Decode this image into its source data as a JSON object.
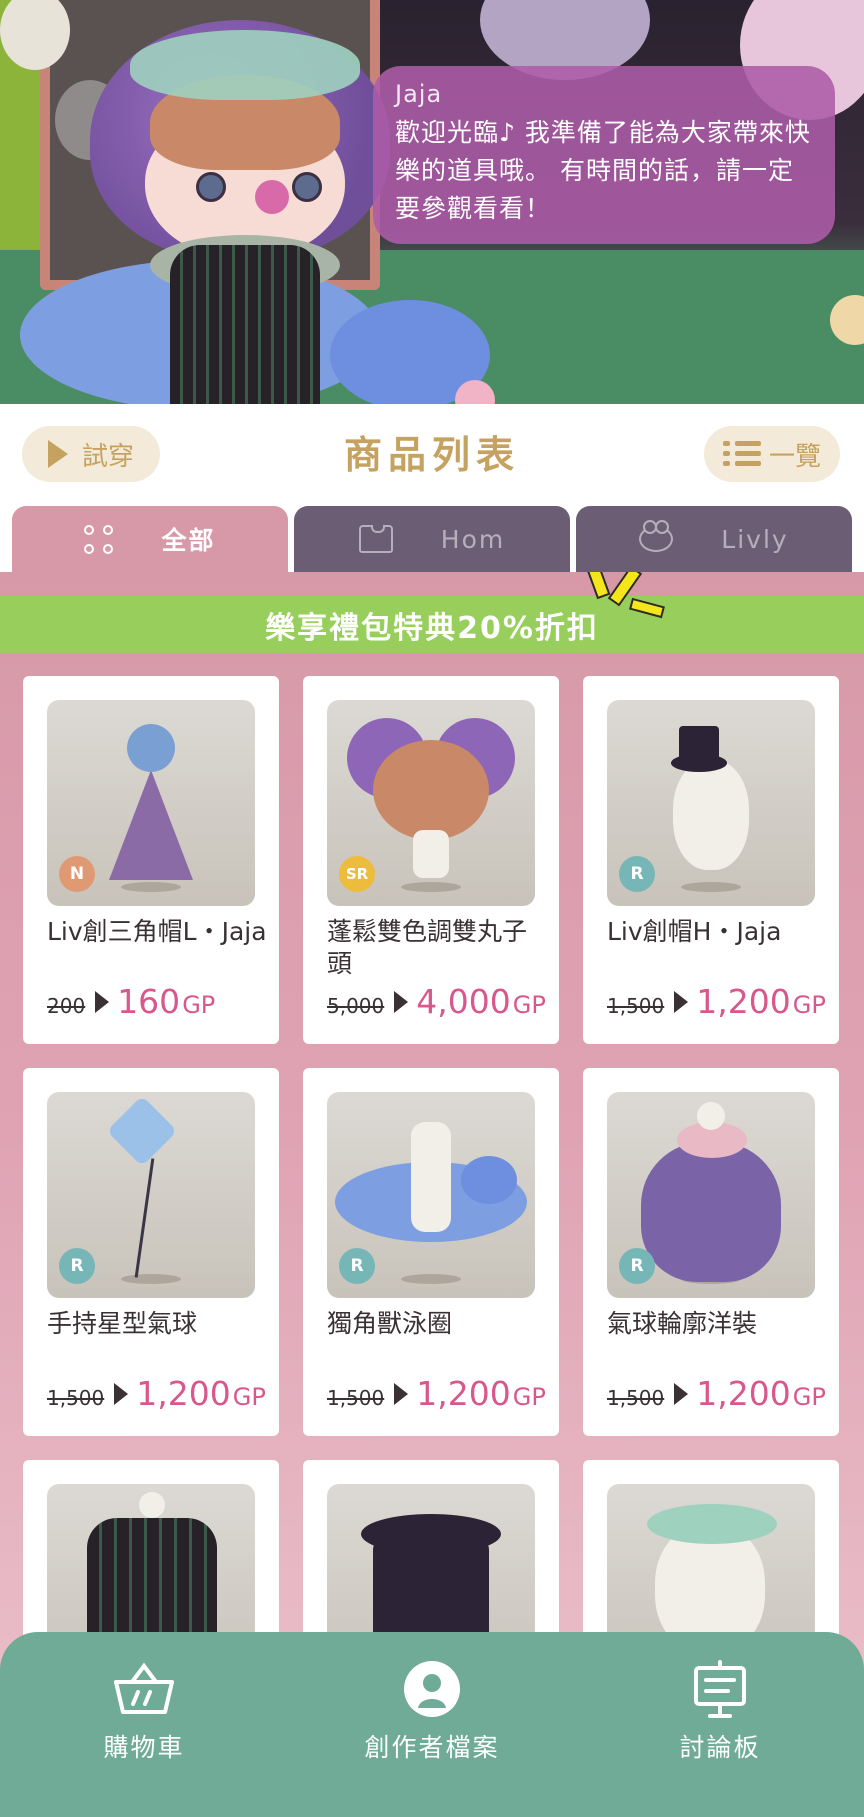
{
  "greeting": {
    "speaker": "Jaja",
    "message": "歡迎光臨♪ 我準備了能為大家帶來快樂的道具哦。 有時間的話，請一定要參觀看看！"
  },
  "header": {
    "try_on_label": "試穿",
    "title": "商品列表",
    "list_label": "一覽"
  },
  "tabs": [
    {
      "label": "全部",
      "icon": "dots-grid-icon",
      "active": true
    },
    {
      "label": "Hom",
      "icon": "shirt-icon",
      "active": false
    },
    {
      "label": "Livly",
      "icon": "pet-face-icon",
      "active": false
    }
  ],
  "promo_banner": "樂享禮包特典20%折扣",
  "products": [
    {
      "name": "Liv創三角帽L・Jaja",
      "rarity": "N",
      "old_price": "200",
      "new_price": "160",
      "currency": "GP"
    },
    {
      "name": "蓬鬆雙色調雙丸子頭",
      "rarity": "SR",
      "old_price": "5,000",
      "new_price": "4,000",
      "currency": "GP"
    },
    {
      "name": "Liv創帽H・Jaja",
      "rarity": "R",
      "old_price": "1,500",
      "new_price": "1,200",
      "currency": "GP"
    },
    {
      "name": "手持星型氣球",
      "rarity": "R",
      "old_price": "1,500",
      "new_price": "1,200",
      "currency": "GP"
    },
    {
      "name": "獨角獸泳圈",
      "rarity": "R",
      "old_price": "1,500",
      "new_price": "1,200",
      "currency": "GP"
    },
    {
      "name": "氣球輪廓洋裝",
      "rarity": "R",
      "old_price": "1,500",
      "new_price": "1,200",
      "currency": "GP"
    }
  ],
  "bottom_nav": [
    {
      "label": "購物車",
      "icon": "basket-icon"
    },
    {
      "label": "創作者檔案",
      "icon": "creator-profile-icon"
    },
    {
      "label": "討論板",
      "icon": "board-icon"
    }
  ],
  "colors": {
    "accent_gold": "#c6a261",
    "tab_active": "#d799a8",
    "tab_inactive": "#6b5e74",
    "promo_green": "#98cf5c",
    "price_pink": "#d8578c",
    "nav_green": "#6fab96"
  }
}
